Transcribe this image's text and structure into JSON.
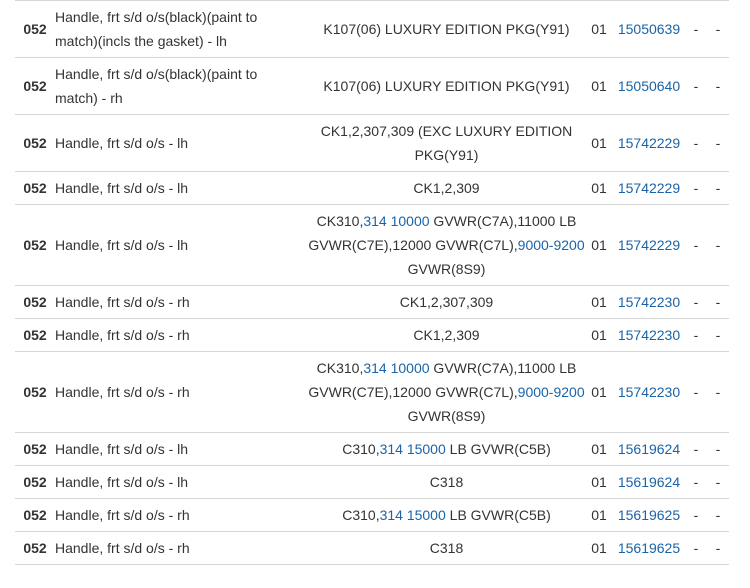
{
  "colors": {
    "link": "#1a63a8",
    "text": "#333333",
    "border": "#d6d6d6"
  },
  "rows": [
    {
      "code": "052",
      "description": "Handle, frt s/d o/s(black)(paint to match)(incls the gasket) - lh",
      "application": [
        {
          "text": "K107(06) LUXURY EDITION PKG(Y91)"
        }
      ],
      "qty": "01",
      "part": "15050639",
      "d1": "-",
      "d2": "-"
    },
    {
      "code": "052",
      "description": "Handle, frt s/d o/s(black)(paint to match) - rh",
      "application": [
        {
          "text": "K107(06) LUXURY EDITION PKG(Y91)"
        }
      ],
      "qty": "01",
      "part": "15050640",
      "d1": "-",
      "d2": "-"
    },
    {
      "code": "052",
      "description": "Handle, frt s/d o/s - lh",
      "application": [
        {
          "text": "CK1,2,307,309 (EXC LUXURY EDITION PKG(Y91)"
        }
      ],
      "qty": "01",
      "part": "15742229",
      "d1": "-",
      "d2": "-"
    },
    {
      "code": "052",
      "description": "Handle, frt s/d o/s - lh",
      "application": [
        {
          "text": "CK1,2,309"
        }
      ],
      "qty": "01",
      "part": "15742229",
      "d1": "-",
      "d2": "-"
    },
    {
      "code": "052",
      "description": "Handle, frt s/d o/s - lh",
      "application": [
        {
          "text": "CK310,"
        },
        {
          "text": "314",
          "link": true
        },
        {
          "text": " "
        },
        {
          "text": "10000",
          "link": true
        },
        {
          "text": " GVWR(C7A),11000 LB GVWR(C7E),12000 GVWR(C7L),"
        },
        {
          "text": "9000-9200",
          "link": true
        },
        {
          "text": " GVWR(8S9)"
        }
      ],
      "qty": "01",
      "part": "15742229",
      "d1": "-",
      "d2": "-"
    },
    {
      "code": "052",
      "description": "Handle, frt s/d o/s - rh",
      "application": [
        {
          "text": "CK1,2,307,309"
        }
      ],
      "qty": "01",
      "part": "15742230",
      "d1": "-",
      "d2": "-"
    },
    {
      "code": "052",
      "description": "Handle, frt s/d o/s - rh",
      "application": [
        {
          "text": "CK1,2,309"
        }
      ],
      "qty": "01",
      "part": "15742230",
      "d1": "-",
      "d2": "-"
    },
    {
      "code": "052",
      "description": "Handle, frt s/d o/s - rh",
      "application": [
        {
          "text": "CK310,"
        },
        {
          "text": "314",
          "link": true
        },
        {
          "text": " "
        },
        {
          "text": "10000",
          "link": true
        },
        {
          "text": " GVWR(C7A),11000 LB GVWR(C7E),12000 GVWR(C7L),"
        },
        {
          "text": "9000-9200",
          "link": true
        },
        {
          "text": " GVWR(8S9)"
        }
      ],
      "qty": "01",
      "part": "15742230",
      "d1": "-",
      "d2": "-"
    },
    {
      "code": "052",
      "description": "Handle, frt s/d o/s - lh",
      "application": [
        {
          "text": "C310,"
        },
        {
          "text": "314",
          "link": true
        },
        {
          "text": " "
        },
        {
          "text": "15000",
          "link": true
        },
        {
          "text": " LB GVWR(C5B)"
        }
      ],
      "qty": "01",
      "part": "15619624",
      "d1": "-",
      "d2": "-"
    },
    {
      "code": "052",
      "description": "Handle, frt s/d o/s - lh",
      "application": [
        {
          "text": "C318"
        }
      ],
      "qty": "01",
      "part": "15619624",
      "d1": "-",
      "d2": "-"
    },
    {
      "code": "052",
      "description": "Handle, frt s/d o/s - rh",
      "application": [
        {
          "text": "C310,"
        },
        {
          "text": "314",
          "link": true
        },
        {
          "text": " "
        },
        {
          "text": "15000",
          "link": true
        },
        {
          "text": " LB GVWR(C5B)"
        }
      ],
      "qty": "01",
      "part": "15619625",
      "d1": "-",
      "d2": "-"
    },
    {
      "code": "052",
      "description": "Handle, frt s/d o/s - rh",
      "application": [
        {
          "text": "C318"
        }
      ],
      "qty": "01",
      "part": "15619625",
      "d1": "-",
      "d2": "-"
    }
  ]
}
